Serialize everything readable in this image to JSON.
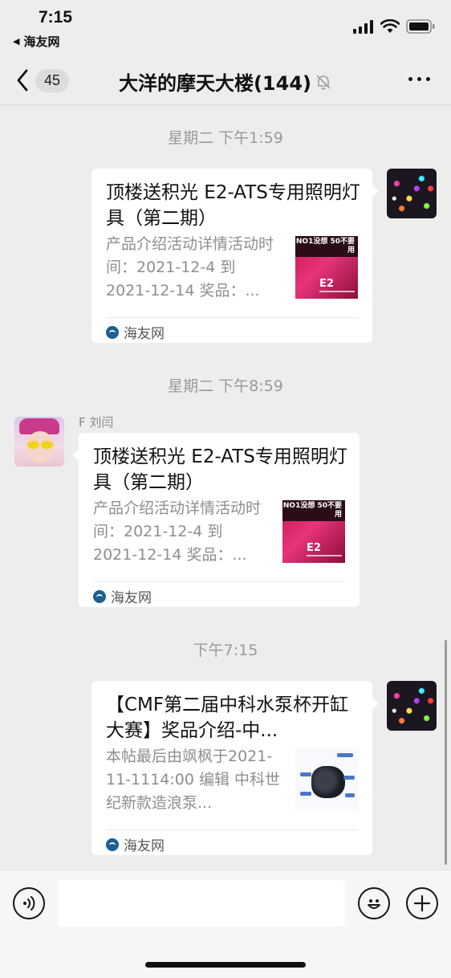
{
  "status_bar": {
    "time": "7:15",
    "back_app": "海友网",
    "icons": [
      "signal-icon",
      "wifi-icon",
      "battery-icon"
    ]
  },
  "nav": {
    "unread_count": "45",
    "title": "大洋的摩天大楼(144)",
    "icons": [
      "back-chevron-icon",
      "mute-bell-icon",
      "more-icon"
    ]
  },
  "messages": [
    {
      "timestamp": "星期二 下午1:59",
      "side": "right",
      "card": {
        "title": "顶楼送积光 E2-ATS专用照明灯具（第二期）",
        "desc": "产品介绍活动详情活动时间：2021-12-4 到 2021-12-14 奖品：...",
        "thumb_text": "NO1没想 50不要用",
        "thumb_brand": "E2",
        "source": "海友网"
      }
    },
    {
      "timestamp": "星期二 下午8:59",
      "side": "left",
      "sender": "F 刘闫",
      "card": {
        "title": "顶楼送积光 E2-ATS专用照明灯具（第二期）",
        "desc": "产品介绍活动详情活动时间：2021-12-4 到 2021-12-14 奖品：...",
        "thumb_text": "NO1没想 50不要用",
        "thumb_brand": "E2",
        "source": "海友网"
      }
    },
    {
      "timestamp": "下午7:15",
      "side": "right",
      "card": {
        "title": "【CMF第二届中科水泵杯开缸大赛】奖品介绍-中...",
        "desc": "本帖最后由飒枫于2021-11-1114:00 编辑 中科世纪新款造浪泵...",
        "source": "海友网"
      }
    }
  ],
  "input_bar": {
    "placeholder": "",
    "icons": [
      "voice-icon",
      "emoji-icon",
      "add-icon"
    ]
  },
  "colors": {
    "background": "#ededed",
    "card": "#ffffff",
    "timestamp_text": "#9a9a9a",
    "desc_text": "#8e8e8e"
  }
}
